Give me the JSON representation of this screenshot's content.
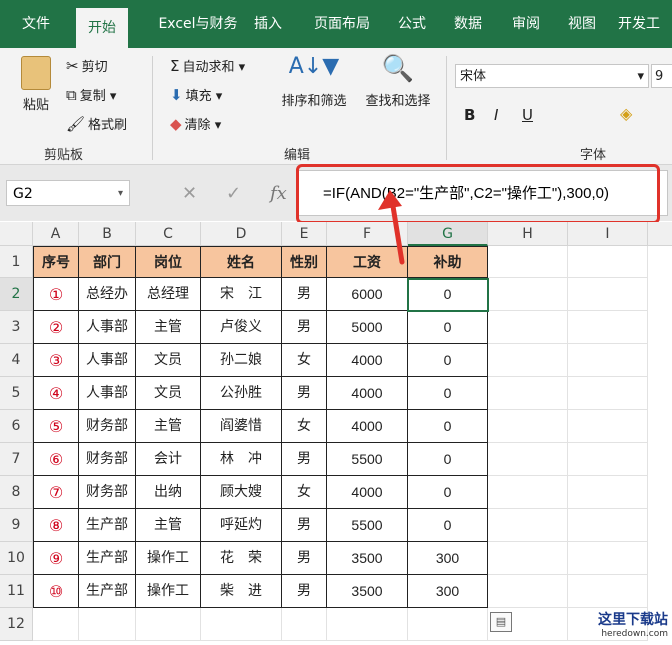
{
  "tabs": [
    "文件",
    "开始",
    "Excel与财务",
    "插入",
    "页面布局",
    "公式",
    "数据",
    "审阅",
    "视图",
    "开发工"
  ],
  "ribbon": {
    "paste": "粘贴",
    "cut": "剪切",
    "copy": "复制",
    "format_painter": "格式刷",
    "clipboard": "剪贴板",
    "autosum": "自动求和",
    "fill": "填充",
    "clear": "清除",
    "sort_filter": "排序和筛选",
    "find_select": "查找和选择",
    "editing": "编辑",
    "font_name": "宋体",
    "font_size": "9",
    "font_group": "字体"
  },
  "namebox": "G2",
  "formula": "=IF(AND(B2=\"生产部\",C2=\"操作工\"),300,0)",
  "columns": [
    "A",
    "B",
    "C",
    "D",
    "E",
    "F",
    "G",
    "H",
    "I"
  ],
  "rows": [
    "1",
    "2",
    "3",
    "4",
    "5",
    "6",
    "7",
    "8",
    "9",
    "10",
    "11",
    "12"
  ],
  "header": [
    "序号",
    "部门",
    "岗位",
    "姓名",
    "性别",
    "工资",
    "补助"
  ],
  "data": [
    [
      "①",
      "总经办",
      "总经理",
      "宋　江",
      "男",
      "6000",
      "0"
    ],
    [
      "②",
      "人事部",
      "主管",
      "卢俊义",
      "男",
      "5000",
      "0"
    ],
    [
      "③",
      "人事部",
      "文员",
      "孙二娘",
      "女",
      "4000",
      "0"
    ],
    [
      "④",
      "人事部",
      "文员",
      "公孙胜",
      "男",
      "4000",
      "0"
    ],
    [
      "⑤",
      "财务部",
      "主管",
      "阎婆惜",
      "女",
      "4000",
      "0"
    ],
    [
      "⑥",
      "财务部",
      "会计",
      "林　冲",
      "男",
      "5500",
      "0"
    ],
    [
      "⑦",
      "财务部",
      "出纳",
      "顾大嫂",
      "女",
      "4000",
      "0"
    ],
    [
      "⑧",
      "生产部",
      "主管",
      "呼延灼",
      "男",
      "5500",
      "0"
    ],
    [
      "⑨",
      "生产部",
      "操作工",
      "花　荣",
      "男",
      "3500",
      "300"
    ],
    [
      "⑩",
      "生产部",
      "操作工",
      "柴　进",
      "男",
      "3500",
      "300"
    ]
  ],
  "watermark": {
    "title": "这里下载站",
    "url": "heredown.com"
  }
}
